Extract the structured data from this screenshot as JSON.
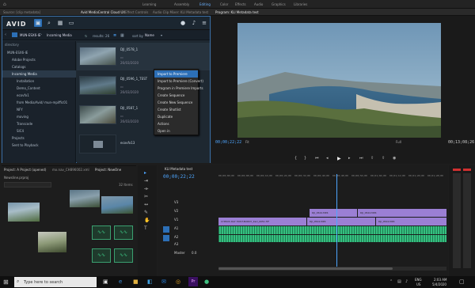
{
  "workspaces": [
    "Learning",
    "Assembly",
    "Editing",
    "Color",
    "Effects",
    "Audio",
    "Graphics",
    "Libraries"
  ],
  "panel_tabs": [
    "Source: [clip metadata]",
    "Avid MediaCentral Cloud UX",
    "Effect Controls",
    "Audio Clip Mixer: KLI Metadata test",
    "Program: KLI Metadata test"
  ],
  "avid": {
    "logo": "AVID",
    "location": "MUN-ESX6-IE",
    "folder": "Incoming Media",
    "results": "results: 26",
    "sort_label": "sort by",
    "sort_value": "Name",
    "tree": [
      "directory",
      "MUN-ESX6-IE",
      "Adobe Projects",
      "Catalogs",
      "Incoming Media",
      "Installation",
      "Demo_Content",
      "ecovfx1",
      "from Media/Avid/ mun-mpiffic01",
      "NFY",
      "moving",
      "Transcode",
      "SIC4",
      "Projects",
      "Sent to Playback"
    ],
    "items": [
      {
        "name": "DJI_0578_1",
        "date": "26/03/2020"
      },
      {
        "name": "DJI_0596_1_TEST",
        "date": "26/03/2020"
      },
      {
        "name": "DJI_0587_1",
        "date": "26/03/2020"
      },
      {
        "name": "ecovfx13",
        "date": ""
      }
    ],
    "context_menu": [
      "Import to Premiere",
      "Import to Premiere (Convert)",
      "Program in Premiere Imports",
      "Create Sequence",
      "Create New Sequence",
      "Create Shotlist",
      "Duplicate",
      "Actions",
      "Open in"
    ]
  },
  "program": {
    "timecode_in": "00;00;22;22",
    "fit": "Fit",
    "ratio": "Full",
    "timecode_out": "00;13;08;26"
  },
  "project": {
    "title": "Project: A Project (opened)",
    "tabs": [
      "mx.nav_CH896002.xml",
      "Project: NewOne"
    ],
    "search": "Newsline.prproj",
    "count": "32 Items"
  },
  "timeline": {
    "title": "KLI Metadata test",
    "timecode": "00;00;22;22",
    "ruler": [
      "00;00;00;00",
      "00;00;08;00",
      "00;00;16;00",
      "00;00;24;00",
      "00;00;32;00",
      "00;00;40;00",
      "00;00;48;00",
      "00;00;56;00",
      "00;01;04;00",
      "00;01;12;00",
      "00;01;20;00",
      "00;01;28;00"
    ],
    "tracks": [
      "V3",
      "V2",
      "V1",
      "A1",
      "A2",
      "A3"
    ],
    "clips": [
      "DJI_0524.MP4",
      "DJI_0524.MP4",
      "CYPRUS DAY HOST-BUDDY_Karl_0051.TIF",
      "DJI_0524.MP4",
      "DJI_0524.MP4"
    ],
    "master": "Master",
    "master_val": "0.0"
  },
  "taskbar": {
    "search": "Type here to search",
    "time": "2:03 AM",
    "date": "5/4/2020",
    "lang": "ENG",
    "region": "US"
  }
}
